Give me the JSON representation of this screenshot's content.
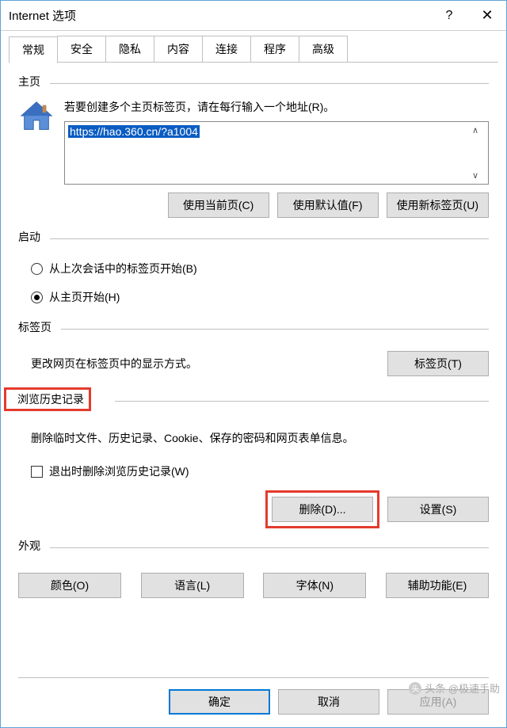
{
  "window": {
    "title": "Internet 选项"
  },
  "tabs": [
    "常规",
    "安全",
    "隐私",
    "内容",
    "连接",
    "程序",
    "高级"
  ],
  "homepage": {
    "label": "主页",
    "hint": "若要创建多个主页标签页，请在每行输入一个地址(R)。",
    "url": "https://hao.360.cn/?a1004",
    "buttons": {
      "current": "使用当前页(C)",
      "default": "使用默认值(F)",
      "newtab": "使用新标签页(U)"
    }
  },
  "startup": {
    "label": "启动",
    "opt_last": "从上次会话中的标签页开始(B)",
    "opt_home": "从主页开始(H)"
  },
  "tabpages": {
    "label": "标签页",
    "hint": "更改网页在标签页中的显示方式。",
    "button": "标签页(T)"
  },
  "history": {
    "label": "浏览历史记录",
    "hint": "删除临时文件、历史记录、Cookie、保存的密码和网页表单信息。",
    "checkbox": "退出时删除浏览历史记录(W)",
    "delete": "删除(D)...",
    "settings": "设置(S)"
  },
  "appearance": {
    "label": "外观",
    "colors": "颜色(O)",
    "languages": "语言(L)",
    "fonts": "字体(N)",
    "accessibility": "辅助功能(E)"
  },
  "footer": {
    "ok": "确定",
    "cancel": "取消",
    "apply": "应用(A)"
  },
  "watermark": "头条 @极速手助"
}
